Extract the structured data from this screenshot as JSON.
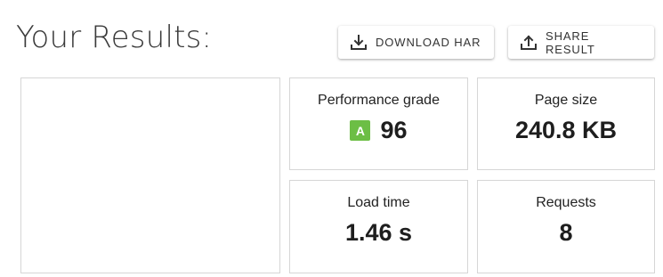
{
  "header": {
    "title": "Your Results:"
  },
  "actions": {
    "download_har": {
      "label": "DOWNLOAD HAR",
      "icon": "download-icon"
    },
    "share_result": {
      "label": "SHARE RESULT",
      "icon": "share-upload-icon"
    }
  },
  "metrics": {
    "performance": {
      "label": "Performance grade",
      "grade": "A",
      "score": "96",
      "grade_color": "#6cbe45"
    },
    "page_size": {
      "label": "Page size",
      "value": "240.8 KB"
    },
    "load_time": {
      "label": "Load time",
      "value": "1.46 s"
    },
    "requests": {
      "label": "Requests",
      "value": "8"
    }
  }
}
